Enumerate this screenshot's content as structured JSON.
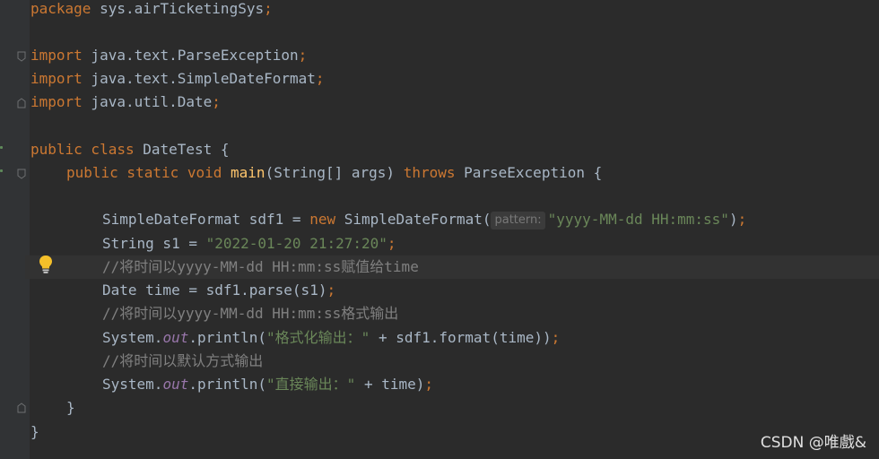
{
  "code": {
    "line_package": {
      "kw": "package",
      "text": " sys.airTicketingSys",
      "semi": ";"
    },
    "line_import1": {
      "kw": "import",
      "text": " java.text.ParseException",
      "semi": ";"
    },
    "line_import2": {
      "kw": "import",
      "text": " java.text.SimpleDateFormat",
      "semi": ";"
    },
    "line_import3": {
      "kw": "import",
      "text": " java.util.Date",
      "semi": ";"
    },
    "line_class": {
      "kw": "public class",
      "text": " DateTest {"
    },
    "line_main": {
      "kw1": "public static void",
      "method": "main",
      "params": "(String[] args) ",
      "kw2": "throws",
      "rest": " ParseException {"
    },
    "line_sdf": {
      "text1": "SimpleDateFormat sdf1 = ",
      "kw": "new",
      "text2": " SimpleDateFormat(",
      "hint": "pattern:",
      "str": "\"yyyy-MM-dd HH:mm:ss\"",
      "end": ")",
      "semi": ";"
    },
    "line_s1": {
      "text": "String s1 = ",
      "str": "\"2022-01-20 21:27:20\"",
      "semi": ";"
    },
    "line_comment1": "//将时间以yyyy-MM-dd HH:mm:ss赋值给time",
    "line_parse": {
      "text": "Date time = sdf1.parse(s1)",
      "semi": ";"
    },
    "line_comment2": "//将时间以yyyy-MM-dd HH:mm:ss格式输出",
    "line_println1": {
      "pre": "System.",
      "field": "out",
      "mid": ".println(",
      "str": "\"格式化输出：\"",
      "post": " + sdf1.format(time))",
      "semi": ";"
    },
    "line_comment3": "//将时间以默认方式输出",
    "line_println2": {
      "pre": "System.",
      "field": "out",
      "mid": ".println(",
      "str": "\"直接输出：\"",
      "post": " + time)",
      "semi": ";"
    },
    "line_close_method": "}",
    "line_close_class": "}"
  },
  "watermark": "CSDN @唯戲&",
  "icons": {
    "fold_marker": "fold-marker-icon",
    "lightbulb": "lightbulb-icon"
  },
  "colors": {
    "background": "#2b2b2b",
    "keyword": "#cc7832",
    "method": "#ffc66d",
    "string": "#6a8759",
    "comment": "#808080",
    "field": "#9876aa",
    "text": "#a9b7c6"
  }
}
